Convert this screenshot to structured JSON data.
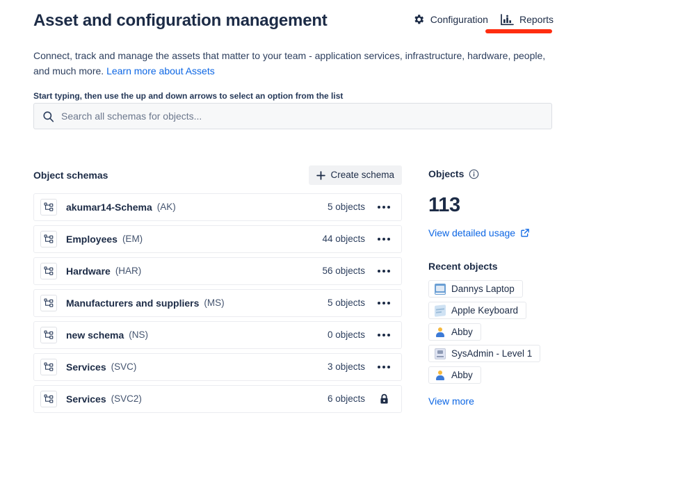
{
  "header": {
    "title": "Asset and configuration management",
    "actions": [
      {
        "label": "Configuration",
        "icon": "gear-icon"
      },
      {
        "label": "Reports",
        "icon": "bar-chart-icon"
      }
    ],
    "annotation_color": "#ff2d10"
  },
  "intro": {
    "text": "Connect, track and manage the assets that matter to your team - application services, infrastructure, hardware, people, and much more. ",
    "link_text": "Learn more about Assets"
  },
  "search": {
    "hint": "Start typing, then use the up and down arrows to select an option from the list",
    "placeholder": "Search all schemas for objects...",
    "value": ""
  },
  "schemas": {
    "section_title": "Object schemas",
    "create_label": "Create schema",
    "rows": [
      {
        "name": "akumar14-Schema",
        "key": "(AK)",
        "count": "5 objects",
        "trailing": "more-actions"
      },
      {
        "name": "Employees",
        "key": "(EM)",
        "count": "44 objects",
        "trailing": "more-actions"
      },
      {
        "name": "Hardware",
        "key": "(HAR)",
        "count": "56 objects",
        "trailing": "more-actions"
      },
      {
        "name": "Manufacturers and suppliers",
        "key": "(MS)",
        "count": "5 objects",
        "trailing": "more-actions"
      },
      {
        "name": "new schema",
        "key": "(NS)",
        "count": "0 objects",
        "trailing": "more-actions"
      },
      {
        "name": "Services",
        "key": "(SVC)",
        "count": "3 objects",
        "trailing": "more-actions"
      },
      {
        "name": "Services",
        "key": "(SVC2)",
        "count": "6 objects",
        "trailing": "lock"
      }
    ]
  },
  "objects": {
    "title": "Objects",
    "info_icon": "info-icon",
    "count": "113",
    "usage_link": "View detailed usage",
    "recent_title": "Recent objects",
    "recent": [
      {
        "label": "Dannys Laptop",
        "icon": "laptop-icon"
      },
      {
        "label": "Apple Keyboard",
        "icon": "keyboard-icon"
      },
      {
        "label": "Abby",
        "icon": "person-icon"
      },
      {
        "label": "SysAdmin - Level 1",
        "icon": "card-icon"
      },
      {
        "label": "Abby",
        "icon": "person-icon"
      }
    ],
    "view_more": "View more"
  },
  "colors": {
    "link": "#0c66e4",
    "text": "#1c2b46",
    "annotation": "#ff2d10"
  }
}
